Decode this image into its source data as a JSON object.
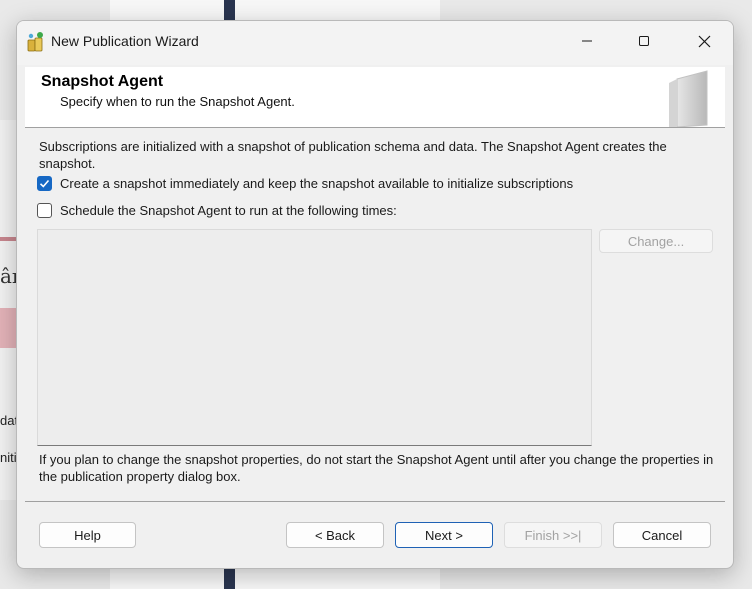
{
  "background": {
    "fragment_1": "âr",
    "fragment_2": "dat",
    "fragment_3": "nitia"
  },
  "window": {
    "title": "New Publication Wizard",
    "icon": "publication-wizard-icon"
  },
  "header": {
    "title": "Snapshot Agent",
    "subtitle": "Specify when to run the Snapshot Agent."
  },
  "body": {
    "description": "Subscriptions are initialized with a snapshot of publication schema and data. The Snapshot Agent creates the snapshot.",
    "create_snapshot": {
      "label": "Create a snapshot immediately and keep the snapshot available to initialize subscriptions",
      "checked": true
    },
    "schedule": {
      "label": "Schedule the Snapshot Agent to run at the following times:",
      "checked": false,
      "schedule_text": ""
    },
    "change_button": "Change...",
    "note": "If you plan to change the snapshot properties, do not start the Snapshot Agent until after you change the properties in the publication property dialog box."
  },
  "buttons": {
    "help": "Help",
    "back": "< Back",
    "next": "Next >",
    "finish": "Finish >>|",
    "cancel": "Cancel"
  },
  "colors": {
    "accent": "#1668c4",
    "dialog_bg": "#f0f0f0"
  }
}
